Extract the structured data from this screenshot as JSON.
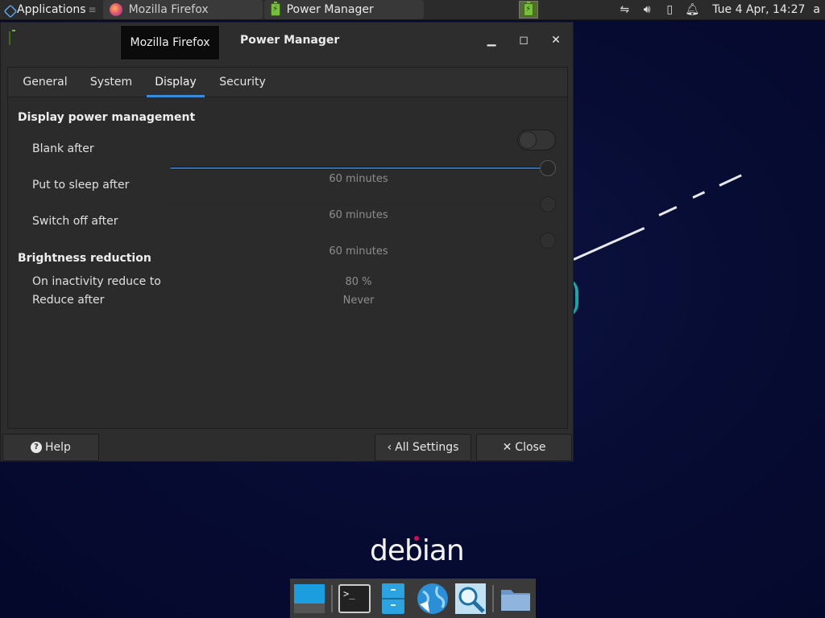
{
  "panel": {
    "applications_label": "Applications",
    "tasks": [
      {
        "label": "Mozilla Firefox"
      },
      {
        "label": "Power Manager"
      }
    ],
    "clock": "Tue  4 Apr, 14:27",
    "user_initial": "a"
  },
  "window": {
    "title": "Power Manager",
    "tooltip": "Mozilla Firefox",
    "tabs": [
      "General",
      "System",
      "Display",
      "Security"
    ],
    "active_tab": "Display",
    "sections": {
      "display_power_management": {
        "title": "Display power management",
        "enabled": false,
        "rows": [
          {
            "label": "Blank after",
            "value": "60 minutes",
            "level": 1.0
          },
          {
            "label": "Put to sleep after",
            "value": "60 minutes",
            "level": 1.0
          },
          {
            "label": "Switch off after",
            "value": "60 minutes",
            "level": 1.0
          }
        ]
      },
      "brightness_reduction": {
        "title": "Brightness reduction",
        "rows": [
          {
            "label": "On inactivity reduce to",
            "value": "80 %"
          },
          {
            "label": "Reduce after",
            "value": "Never"
          }
        ]
      }
    },
    "buttons": {
      "help": "Help",
      "all_settings": "All Settings",
      "close": "Close"
    }
  },
  "desktop": {
    "logo_text": "debian"
  },
  "colors": {
    "accent": "#3a8ad8",
    "panel_bg": "#2b2b2b",
    "window_bg": "#2d2d2d",
    "desktop_bg": "#050a2c"
  }
}
